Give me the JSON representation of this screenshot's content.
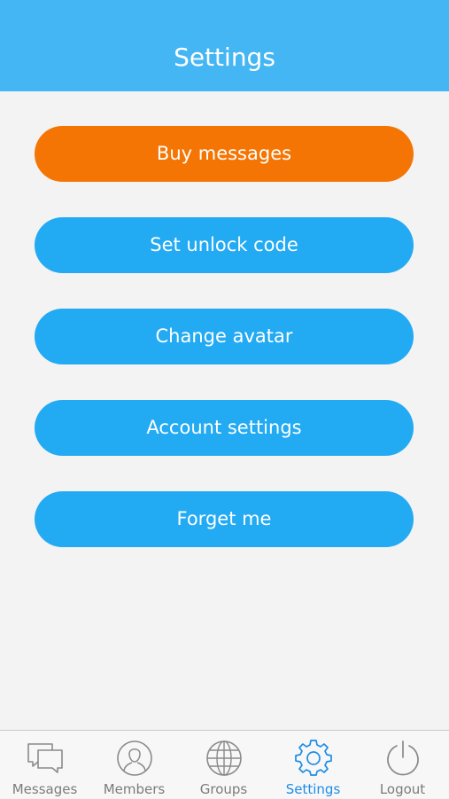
{
  "header": {
    "title": "Settings"
  },
  "actions": [
    {
      "label": "Buy messages",
      "color": "#f47503"
    },
    {
      "label": "Set unlock code",
      "color": "#22aaf3"
    },
    {
      "label": "Change avatar",
      "color": "#22aaf3"
    },
    {
      "label": "Account settings",
      "color": "#22aaf3"
    },
    {
      "label": "Forget me",
      "color": "#22aaf3"
    }
  ],
  "tabbar": {
    "active_color": "#1b8de6",
    "inactive_color": "#7b7b7b",
    "tabs": [
      {
        "label": "Messages",
        "icon": "chat-bubbles-icon",
        "active": false
      },
      {
        "label": "Members",
        "icon": "person-circle-icon",
        "active": false
      },
      {
        "label": "Groups",
        "icon": "globe-icon",
        "active": false
      },
      {
        "label": "Settings",
        "icon": "gear-icon",
        "active": true
      },
      {
        "label": "Logout",
        "icon": "power-icon",
        "active": false
      }
    ]
  }
}
